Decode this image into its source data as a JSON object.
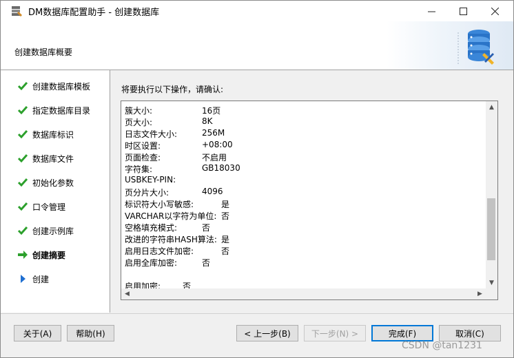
{
  "window": {
    "title": "DM数据库配置助手 - 创建数据库",
    "minimize": "—",
    "maximize": "☐",
    "close": "✕"
  },
  "header": {
    "title": "创建数据库概要",
    "icon": "database-config-icon"
  },
  "sidebar": {
    "steps": [
      {
        "label": "创建数据库模板",
        "state": "done"
      },
      {
        "label": "指定数据库目录",
        "state": "done"
      },
      {
        "label": "数据库标识",
        "state": "done"
      },
      {
        "label": "数据库文件",
        "state": "done"
      },
      {
        "label": "初始化参数",
        "state": "done"
      },
      {
        "label": "口令管理",
        "state": "done"
      },
      {
        "label": "创建示例库",
        "state": "done"
      },
      {
        "label": "创建摘要",
        "state": "current"
      },
      {
        "label": "创建",
        "state": "pending"
      }
    ]
  },
  "main": {
    "prompt": "将要执行以下操作，请确认:",
    "summary": [
      {
        "key": "簇大小:",
        "value": "16页"
      },
      {
        "key": "页大小:",
        "value": "8K"
      },
      {
        "key": "日志文件大小:",
        "value": "256M"
      },
      {
        "key": "时区设置:",
        "value": "+08:00"
      },
      {
        "key": "页面检查:",
        "value": "不启用"
      },
      {
        "key": "字符集:",
        "value": "GB18030"
      },
      {
        "key": "USBKEY-PIN:",
        "value": ""
      },
      {
        "key": "页分片大小:",
        "value": "4096"
      },
      {
        "key": "标识符大小写敏感:",
        "value": "是"
      },
      {
        "key": "VARCHAR以字符为单位:",
        "value": "否"
      },
      {
        "key": "空格填充模式:",
        "value": "否"
      },
      {
        "key": "改进的字符串HASH算法:",
        "value": "是"
      },
      {
        "key": "启用日志文件加密:",
        "value": "否"
      },
      {
        "key": "启用全库加密:",
        "value": "否"
      },
      {
        "key": "",
        "value": ""
      },
      {
        "key": "启用加密:",
        "value": "否"
      }
    ]
  },
  "footer": {
    "about": "关于(A)",
    "help": "帮助(H)",
    "prev": "< 上一步(B)",
    "next": "下一步(N) >",
    "finish": "完成(F)",
    "cancel": "取消(C)"
  },
  "watermark": "CSDN @tan1231",
  "colors": {
    "check": "#2ca02c",
    "arrow": "#2ca02c",
    "pending": "#1f6fd1",
    "accent": "#0078d7"
  }
}
